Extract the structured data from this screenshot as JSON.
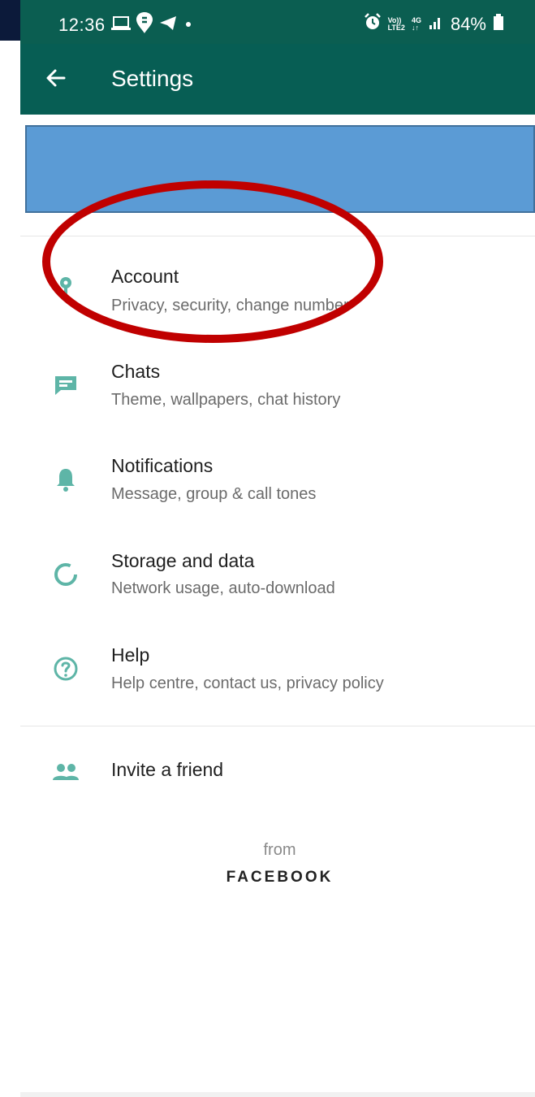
{
  "status_bar": {
    "time": "12:36",
    "volte": "Vo))",
    "lte": "LTE2",
    "network": "4G",
    "battery": "84%"
  },
  "app_bar": {
    "title": "Settings"
  },
  "items": [
    {
      "title": "Account",
      "subtitle": "Privacy, security, change number",
      "icon": "key-icon"
    },
    {
      "title": "Chats",
      "subtitle": "Theme, wallpapers, chat history",
      "icon": "chat-icon"
    },
    {
      "title": "Notifications",
      "subtitle": "Message, group & call tones",
      "icon": "bell-icon"
    },
    {
      "title": "Storage and data",
      "subtitle": "Network usage, auto-download",
      "icon": "storage-icon"
    },
    {
      "title": "Help",
      "subtitle": "Help centre, contact us, privacy policy",
      "icon": "help-icon"
    }
  ],
  "invite": {
    "title": "Invite a friend",
    "icon": "people-icon"
  },
  "footer": {
    "from": "from",
    "brand": "FACEBOOK"
  },
  "colors": {
    "header": "#075e54",
    "status": "#0b5e51",
    "icon": "#5eb5a7",
    "redaction": "#5b9bd5",
    "annotation": "#c00000"
  }
}
